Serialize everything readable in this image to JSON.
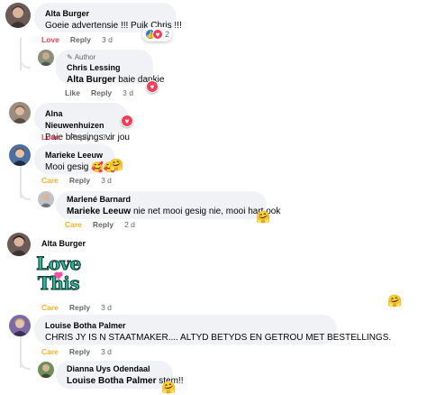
{
  "comments": [
    {
      "name": "Alta Burger",
      "text": "Goeie advertensie !!! Puik Chris !!!",
      "actions": [
        "Love",
        "Reply",
        "3 d"
      ],
      "reaction_count": "2",
      "reaction_icons": [
        "like-icon",
        "love-icon"
      ]
    },
    {
      "author_tag": "Author",
      "name": "Chris Lessing",
      "mention": "Alta Burger",
      "text": "baie dankie",
      "actions": [
        "Like",
        "Reply",
        "3 d"
      ],
      "reaction_icons": [
        "love-icon"
      ]
    },
    {
      "name": "Alna Nieuwenhuizen",
      "text": "Baie blessings vir jou",
      "actions": [
        "Love",
        "Reply",
        "3 d"
      ],
      "reaction_icons": [
        "love-icon"
      ]
    },
    {
      "name": "Marieke Leeuw",
      "text": "Mooi gesig",
      "text_emojis": [
        "🥰",
        "🥰",
        "🤗"
      ],
      "actions": [
        "Care",
        "Reply",
        "3 d"
      ]
    },
    {
      "name": "Marlené Barnard",
      "mention": "Marieke Leeuw",
      "text": "nie net mooi gesig nie, mooi hart ook",
      "actions": [
        "Care",
        "Reply",
        "2 d"
      ],
      "reaction_emoji": "🤗"
    },
    {
      "name": "Alta Burger",
      "sticker_text": [
        "Love",
        "This"
      ],
      "actions": [
        "Care",
        "Reply",
        "3 d"
      ],
      "reaction_emoji": "🤗"
    },
    {
      "name": "Louise Botha Palmer",
      "text": "CHRIS JY IS N STAATMAKER.... ALTYD BETYDS EN GETROU MET BESTELLINGS.",
      "actions": [
        "Care",
        "Reply",
        "3 d"
      ]
    },
    {
      "name": "Dianna Uys Odendaal",
      "mention": "Louise Botha Palmer",
      "text": "stem!!",
      "reaction_emoji": "🤗"
    }
  ],
  "colors": {
    "love": "#f33e58",
    "care": "#f7b125",
    "like_blue": "#1877f2",
    "bubble": "#f0f2f5",
    "meta": "#65676b"
  }
}
